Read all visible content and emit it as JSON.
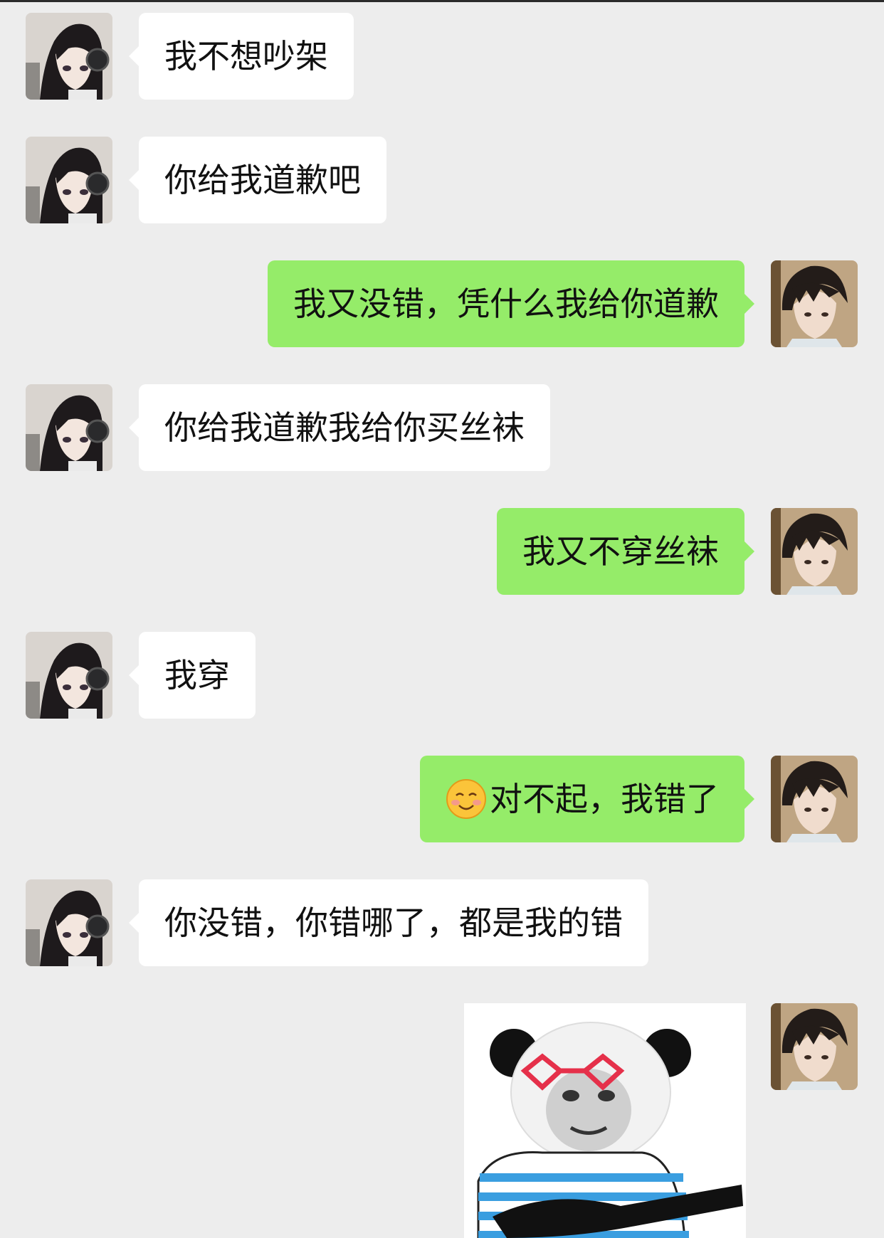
{
  "conversation": {
    "messages": [
      {
        "side": "in",
        "text": "我不想吵架"
      },
      {
        "side": "in",
        "text": "你给我道歉吧"
      },
      {
        "side": "out",
        "text": "我又没错，凭什么我给你道歉"
      },
      {
        "side": "in",
        "text": "你给我道歉我给你买丝袜"
      },
      {
        "side": "out",
        "text": "我又不穿丝袜"
      },
      {
        "side": "in",
        "text": "我穿"
      },
      {
        "side": "out",
        "emoji": "smiling-face",
        "text": "对不起，我错了"
      },
      {
        "side": "in",
        "text": "你没错，你错哪了，都是我的错"
      },
      {
        "side": "out",
        "sticker": "panda-meme-with-red-glasses"
      }
    ]
  },
  "colors": {
    "background": "#ededed",
    "incoming_bubble": "#ffffff",
    "outgoing_bubble": "#95ec69"
  }
}
